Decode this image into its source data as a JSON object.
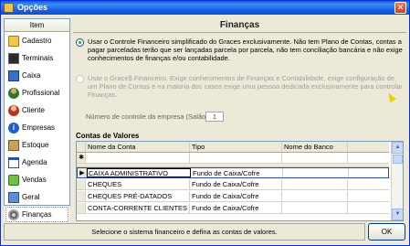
{
  "window": {
    "title": "Opções",
    "close_glyph": "✕"
  },
  "nav": {
    "header": "Item",
    "items": [
      {
        "label": "Cadastro",
        "icon": "folder-icon"
      },
      {
        "label": "Terminais",
        "icon": "terminal-icon"
      },
      {
        "label": "Caixa",
        "icon": "cash-icon"
      },
      {
        "label": "Profissional",
        "icon": "person-icon"
      },
      {
        "label": "Cliente",
        "icon": "client-icon"
      },
      {
        "label": "Empresas",
        "icon": "info-icon"
      },
      {
        "label": "Estoque",
        "icon": "box-icon"
      },
      {
        "label": "Agenda",
        "icon": "agenda-icon"
      },
      {
        "label": "Vendas",
        "icon": "sales-icon"
      },
      {
        "label": "Geral",
        "icon": "general-icon"
      },
      {
        "label": "Finanças",
        "icon": "finance-icon"
      }
    ]
  },
  "main": {
    "title": "Finanças",
    "option_simple": "Usar o Controle Financeiro simplificado do Graces exclusivamente. Não tem Plano de Contas, contas a pagar parceladas terão que ser lançadas parcela por parcela, não tem conciliação bancária e não exige conhecimentos de finanças e/ou contabilidade.",
    "option_full": "Usar o Grace$ Financeiro. Exige conhecimentos de Finanças e Contabilidade, exige configuração de um Plano de Contas e na maioria dos casos exige uma pessoa dedicada exclusivamente para controlar Finanças.",
    "control_label": "Número de controle da empresa (Salão)",
    "control_value": "1",
    "contas_label": "Contas de Valores"
  },
  "grid": {
    "columns": [
      "Nome da Conta",
      "Tipo",
      "Nome do Banco"
    ],
    "new_row_marker": "✱",
    "current_row_marker": "▶",
    "rows": [
      {
        "name": "CAIXA ADMINISTRATIVO",
        "type": "Fundo de Caixa/Cofre",
        "bank": ""
      },
      {
        "name": "CHEQUES",
        "type": "Fundo de Caixa/Cofre",
        "bank": ""
      },
      {
        "name": "CHEQUES PRÉ-DATADOS",
        "type": "Fundo de Caixa/Cofre",
        "bank": ""
      },
      {
        "name": "CONTA-CORRENTE CLIENTES",
        "type": "Fundo de Caixa/Cofre",
        "bank": ""
      }
    ]
  },
  "status_text": "Selecione o sistema financeiro e defina as contas de valores.",
  "ok_label": "OK"
}
